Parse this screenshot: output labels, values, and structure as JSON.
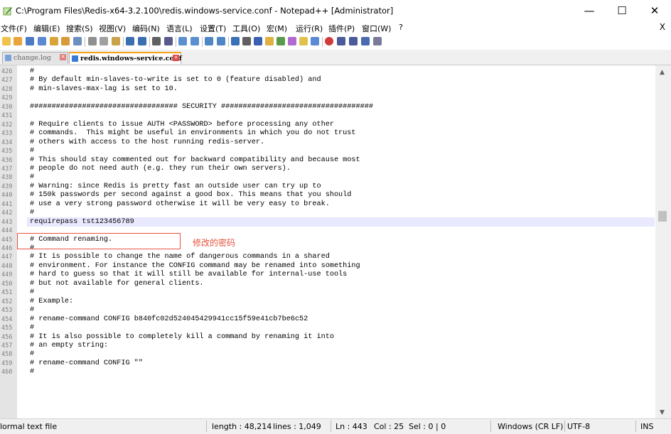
{
  "window": {
    "title": "C:\\Program Files\\Redis-x64-3.2.100\\redis.windows-service.conf - Notepad++ [Administrator]",
    "minimize": "—",
    "maximize": "☐",
    "close": "✕"
  },
  "menu": {
    "items": [
      "文件(F)",
      "编辑(E)",
      "搜索(S)",
      "视图(V)",
      "编码(N)",
      "语言(L)",
      "设置(T)",
      "工具(O)",
      "宏(M)",
      "运行(R)",
      "插件(P)",
      "窗口(W)",
      "?"
    ],
    "close_doc": "X"
  },
  "tabs": [
    {
      "label": "change.log",
      "active": false
    },
    {
      "label": "redis.windows-service.conf",
      "active": true
    }
  ],
  "editor": {
    "current_line": 443,
    "lines": [
      {
        "n": "426",
        "text": "#"
      },
      {
        "n": "427",
        "text": "# By default min-slaves-to-write is set to 0 (feature disabled) and"
      },
      {
        "n": "428",
        "text": "# min-slaves-max-lag is set to 10."
      },
      {
        "n": "429",
        "text": ""
      },
      {
        "n": "430",
        "text": "################################## SECURITY ###################################"
      },
      {
        "n": "431",
        "text": ""
      },
      {
        "n": "432",
        "text": "# Require clients to issue AUTH <PASSWORD> before processing any other"
      },
      {
        "n": "433",
        "text": "# commands.  This might be useful in environments in which you do not trust"
      },
      {
        "n": "434",
        "text": "# others with access to the host running redis-server."
      },
      {
        "n": "435",
        "text": "#"
      },
      {
        "n": "436",
        "text": "# This should stay commented out for backward compatibility and because most"
      },
      {
        "n": "437",
        "text": "# people do not need auth (e.g. they run their own servers)."
      },
      {
        "n": "438",
        "text": "#"
      },
      {
        "n": "439",
        "text": "# Warning: since Redis is pretty fast an outside user can try up to"
      },
      {
        "n": "440",
        "text": "# 150k passwords per second against a good box. This means that you should"
      },
      {
        "n": "441",
        "text": "# use a very strong password otherwise it will be very easy to break."
      },
      {
        "n": "442",
        "text": "#"
      },
      {
        "n": "443",
        "text": "requirepass tst123456789"
      },
      {
        "n": "444",
        "text": ""
      },
      {
        "n": "445",
        "text": "# Command renaming."
      },
      {
        "n": "446",
        "text": "#"
      },
      {
        "n": "447",
        "text": "# It is possible to change the name of dangerous commands in a shared"
      },
      {
        "n": "448",
        "text": "# environment. For instance the CONFIG command may be renamed into something"
      },
      {
        "n": "449",
        "text": "# hard to guess so that it will still be available for internal-use tools"
      },
      {
        "n": "450",
        "text": "# but not available for general clients."
      },
      {
        "n": "451",
        "text": "#"
      },
      {
        "n": "452",
        "text": "# Example:"
      },
      {
        "n": "453",
        "text": "#"
      },
      {
        "n": "454",
        "text": "# rename-command CONFIG b840fc02d524045429941cc15f59e41cb7be6c52"
      },
      {
        "n": "455",
        "text": "#"
      },
      {
        "n": "456",
        "text": "# It is also possible to completely kill a command by renaming it into"
      },
      {
        "n": "457",
        "text": "# an empty string:"
      },
      {
        "n": "458",
        "text": "#"
      },
      {
        "n": "459",
        "text": "# rename-command CONFIG \"\""
      },
      {
        "n": "460",
        "text": "#"
      }
    ]
  },
  "annotation": "修改的密码",
  "status": {
    "file_type": "lormal text file",
    "length": "length : 48,214",
    "lines": "lines : 1,049",
    "ln": "Ln : 443",
    "col": "Col : 25",
    "sel": "Sel : 0 | 0",
    "eol": "Windows (CR LF)",
    "encoding": "UTF-8",
    "mode": "INS"
  },
  "scroll": {
    "up": "▲",
    "down": "▼"
  },
  "colors": {
    "annotation": "#e5533d",
    "current_line": "#e8e8ff",
    "active_tab_accent": "#f7a21b"
  }
}
